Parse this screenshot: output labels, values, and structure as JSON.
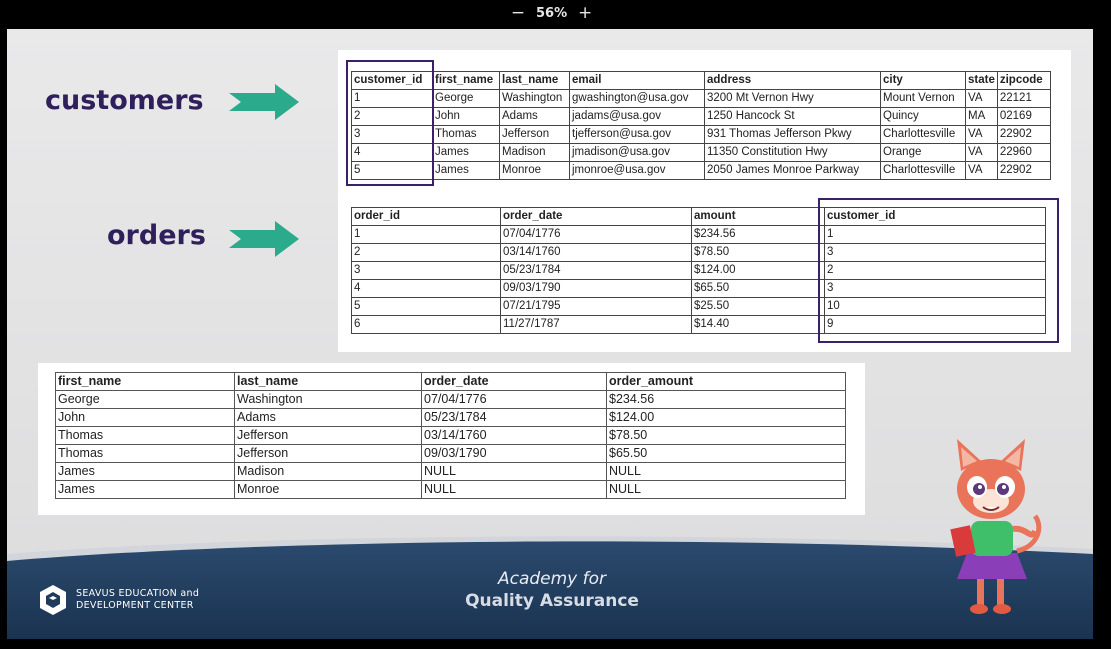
{
  "viewer": {
    "zoom_out": "−",
    "zoom_level": "56%",
    "zoom_in": "+"
  },
  "labels": {
    "customers": "customers",
    "orders": "orders"
  },
  "customers_table": {
    "headers": [
      "customer_id",
      "first_name",
      "last_name",
      "email",
      "address",
      "city",
      "state",
      "zipcode"
    ],
    "rows": [
      [
        "1",
        "George",
        "Washington",
        "gwashington@usa.gov",
        "3200 Mt Vernon Hwy",
        "Mount Vernon",
        "VA",
        "22121"
      ],
      [
        "2",
        "John",
        "Adams",
        "jadams@usa.gov",
        "1250 Hancock St",
        "Quincy",
        "MA",
        "02169"
      ],
      [
        "3",
        "Thomas",
        "Jefferson",
        "tjefferson@usa.gov",
        "931 Thomas Jefferson Pkwy",
        "Charlottesville",
        "VA",
        "22902"
      ],
      [
        "4",
        "James",
        "Madison",
        "jmadison@usa.gov",
        "11350 Constitution Hwy",
        "Orange",
        "VA",
        "22960"
      ],
      [
        "5",
        "James",
        "Monroe",
        "jmonroe@usa.gov",
        "2050 James Monroe Parkway",
        "Charlottesville",
        "VA",
        "22902"
      ]
    ]
  },
  "orders_table": {
    "headers": [
      "order_id",
      "order_date",
      "amount",
      "customer_id"
    ],
    "rows": [
      [
        "1",
        "07/04/1776",
        "$234.56",
        "1"
      ],
      [
        "2",
        "03/14/1760",
        "$78.50",
        "3"
      ],
      [
        "3",
        "05/23/1784",
        "$124.00",
        "2"
      ],
      [
        "4",
        "09/03/1790",
        "$65.50",
        "3"
      ],
      [
        "5",
        "07/21/1795",
        "$25.50",
        "10"
      ],
      [
        "6",
        "11/27/1787",
        "$14.40",
        "9"
      ]
    ]
  },
  "result_table": {
    "headers": [
      "first_name",
      "last_name",
      "order_date",
      "order_amount"
    ],
    "rows": [
      [
        "George",
        "Washington",
        "07/04/1776",
        "$234.56"
      ],
      [
        "John",
        "Adams",
        "05/23/1784",
        "$124.00"
      ],
      [
        "Thomas",
        "Jefferson",
        "03/14/1760",
        "$78.50"
      ],
      [
        "Thomas",
        "Jefferson",
        "09/03/1790",
        "$65.50"
      ],
      [
        "James",
        "Madison",
        "NULL",
        "NULL"
      ],
      [
        "James",
        "Monroe",
        "NULL",
        "NULL"
      ]
    ]
  },
  "footer": {
    "org_line1": "SEAVUS EDUCATION and",
    "org_line2": "DEVELOPMENT CENTER",
    "academy_line1": "Academy for",
    "academy_line2": "Quality Assurance"
  },
  "colors": {
    "label": "#2f1f5b",
    "arrow": "#2bab8c",
    "highlight": "#3b1f6b",
    "footer_wave": "#1f3a5a"
  },
  "icons": {
    "logo": "seavus-cube-logo",
    "mascot": "cat-mascot-illustration",
    "arrow": "right-arrow-icon"
  }
}
